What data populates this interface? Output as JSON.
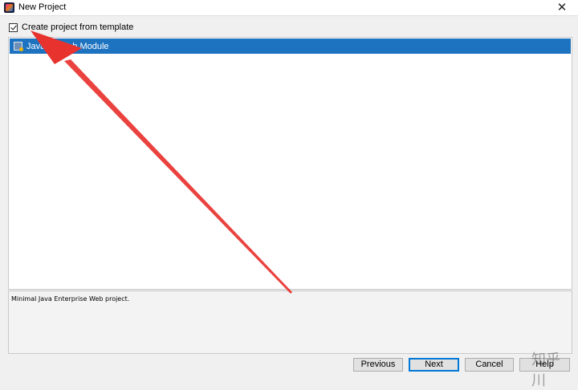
{
  "window": {
    "title": "New Project",
    "close_glyph": "✕",
    "app_icon_letter": "IJ"
  },
  "checkbox": {
    "label": "Create project from template",
    "checked": true
  },
  "templates": {
    "items": [
      {
        "label": "JavaEE Web Module",
        "selected": true
      }
    ]
  },
  "description": {
    "text": "Minimal Java Enterprise Web project."
  },
  "buttons": {
    "previous": "Previous",
    "next": "Next",
    "cancel": "Cancel",
    "help": "Help"
  },
  "annotation": {
    "color": "#e8322e"
  },
  "watermark": {
    "text": "知乎 川"
  }
}
